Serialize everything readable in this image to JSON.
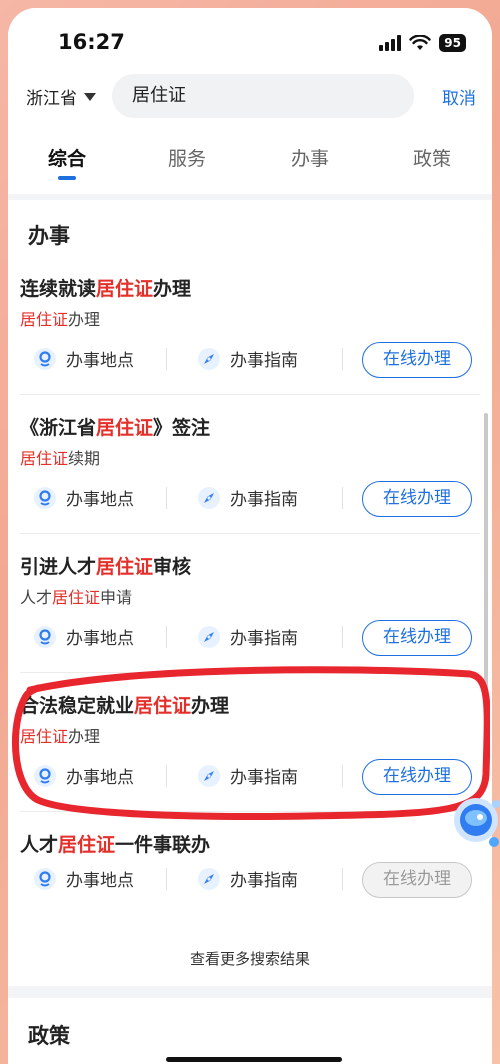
{
  "status": {
    "time": "16:27",
    "battery": "95"
  },
  "search": {
    "region": "浙江省",
    "query": "居住证",
    "cancel": "取消"
  },
  "tabs": [
    "综合",
    "服务",
    "办事",
    "政策"
  ],
  "section_banshi": "办事",
  "items": [
    {
      "title_pre": "连续就读",
      "title_hl": "居住证",
      "title_post": "办理",
      "sub_pre": "",
      "sub_hl": "居住证",
      "sub_post": "办理",
      "place": "办事地点",
      "guide": "办事指南",
      "button": "在线办理",
      "disabled": false
    },
    {
      "title_pre": "《浙江省",
      "title_hl": "居住证",
      "title_post": "》签注",
      "sub_pre": "",
      "sub_hl": "居住证",
      "sub_post": "续期",
      "place": "办事地点",
      "guide": "办事指南",
      "button": "在线办理",
      "disabled": false
    },
    {
      "title_pre": "引进人才",
      "title_hl": "居住证",
      "title_post": "审核",
      "sub_pre": "人才",
      "sub_hl": "居住证",
      "sub_post": "申请",
      "place": "办事地点",
      "guide": "办事指南",
      "button": "在线办理",
      "disabled": false
    },
    {
      "title_pre": "合法稳定就业",
      "title_hl": "居住证",
      "title_post": "办理",
      "sub_pre": "",
      "sub_hl": "居住证",
      "sub_post": "办理",
      "place": "办事地点",
      "guide": "办事指南",
      "button": "在线办理",
      "disabled": false
    },
    {
      "title_pre": "人才",
      "title_hl": "居住证",
      "title_post": "一件事联办",
      "sub_pre": "",
      "sub_hl": "",
      "sub_post": "",
      "place": "办事地点",
      "guide": "办事指南",
      "button": "在线办理",
      "disabled": true
    }
  ],
  "more_results": "查看更多搜索结果",
  "section_zhengce": "政策",
  "colors": {
    "accent": "#1e6fe0",
    "highlight": "#e4302b",
    "annotation": "#e8262e"
  },
  "icons": {
    "place": "location-pin-icon",
    "guide": "compass-icon",
    "assistant": "assistant-robot-icon"
  }
}
